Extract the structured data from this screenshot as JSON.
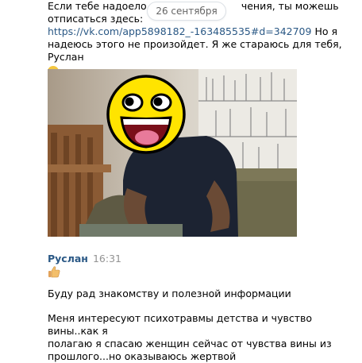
{
  "top_message": {
    "line1": "Если тебе надоело полу",
    "line1_tail": "чения, ты можешь",
    "line2": "отписаться здесь:",
    "link": "https://vk.com/app5898182_-163485535#d=342709",
    "after_link": " Но я",
    "line4": "надеюсь этого не произойдет. Я же стараюсь для тебя, Руслан"
  },
  "date_pill": "26 сентября",
  "icons": {
    "smile": "smiling-face-icon",
    "thumb": "thumbs-up-icon",
    "face_sticker": "awesome-face-icon"
  },
  "message": {
    "author": "Руслан",
    "time": "16:31",
    "paragraph1": "Буду рад знакомству и полезной информации",
    "paragraph2_line1": "Меня интересуют психотравмы детства и чувство вины..как я",
    "paragraph2_line2": "полагаю я спасаю женщин сейчас от чувства вины из",
    "paragraph2_line3": "прошлого...но оказываюсь жертвой"
  },
  "colors": {
    "link": "#2a5885",
    "author": "#2a5885",
    "time": "#939393"
  }
}
